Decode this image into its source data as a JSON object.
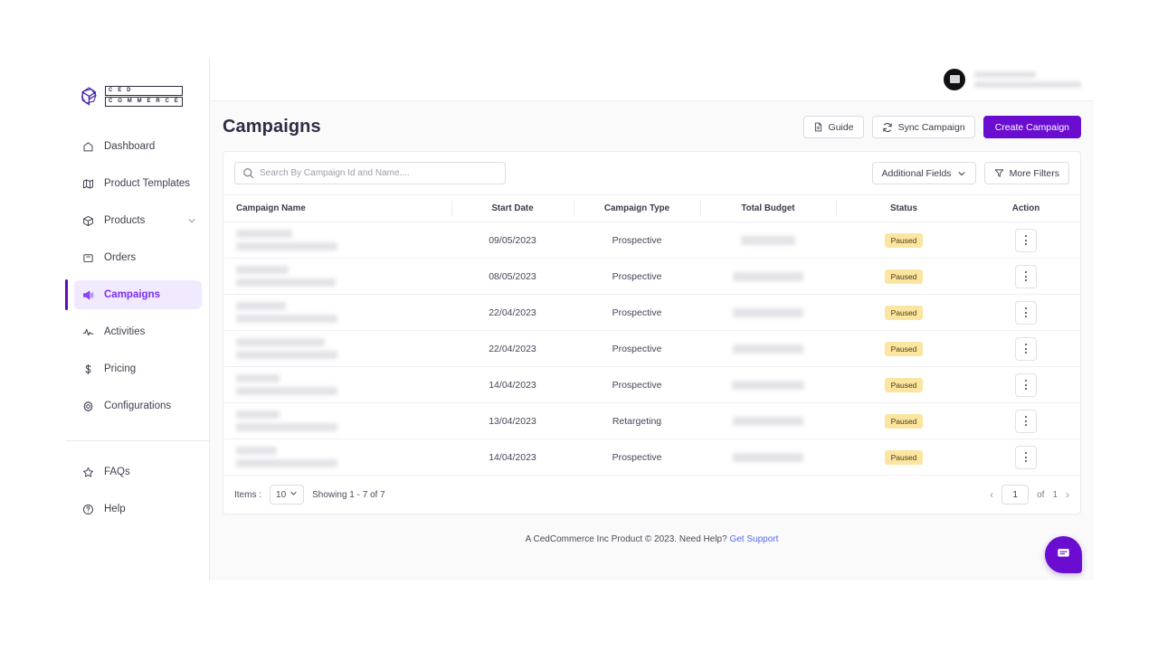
{
  "brand": {
    "name_line1": "C E D",
    "name_line2": "C O M M E R C E",
    "accent": "#6a0dd0",
    "active_bg": "#f1eaff",
    "active_text": "#7b2ff2"
  },
  "sidebar": {
    "items": [
      {
        "label": "Dashboard",
        "icon": "home-icon",
        "active": false,
        "chevron": false
      },
      {
        "label": "Product Templates",
        "icon": "map-icon",
        "active": false,
        "chevron": false
      },
      {
        "label": "Products",
        "icon": "box-icon",
        "active": false,
        "chevron": true
      },
      {
        "label": "Orders",
        "icon": "bag-icon",
        "active": false,
        "chevron": false
      },
      {
        "label": "Campaigns",
        "icon": "megaphone-icon",
        "active": true,
        "chevron": false
      },
      {
        "label": "Activities",
        "icon": "activity-icon",
        "active": false,
        "chevron": false
      },
      {
        "label": "Pricing",
        "icon": "dollar-icon",
        "active": false,
        "chevron": false
      },
      {
        "label": "Configurations",
        "icon": "gear-icon",
        "active": false,
        "chevron": false
      }
    ],
    "bottom_items": [
      {
        "label": "FAQs",
        "icon": "star-icon"
      },
      {
        "label": "Help",
        "icon": "question-circle-icon"
      }
    ]
  },
  "topbar": {
    "avatar": "user-avatar",
    "user_name_redacted": true
  },
  "header": {
    "title": "Campaigns",
    "guide_label": "Guide",
    "sync_label": "Sync Campaign",
    "create_label": "Create Campaign"
  },
  "search": {
    "value": "",
    "placeholder": "Search By Campaign Id and Name...."
  },
  "filters": {
    "additional_fields_label": "Additional Fields",
    "more_filters_label": "More Filters"
  },
  "table": {
    "columns": [
      "Campaign Name",
      "Start Date",
      "Campaign Type",
      "Total Budget",
      "Status",
      "Action"
    ],
    "rows": [
      {
        "name_redacted": true,
        "name_w1": 62,
        "name_w2": 112,
        "start_date": "09/05/2023",
        "type": "Prospective",
        "budget_redacted": true,
        "budget_w": 60,
        "status": "Paused"
      },
      {
        "name_redacted": true,
        "name_w1": 58,
        "name_w2": 110,
        "start_date": "08/05/2023",
        "type": "Prospective",
        "budget_redacted": true,
        "budget_w": 78,
        "status": "Paused"
      },
      {
        "name_redacted": true,
        "name_w1": 55,
        "name_w2": 112,
        "start_date": "22/04/2023",
        "type": "Prospective",
        "budget_redacted": true,
        "budget_w": 78,
        "status": "Paused"
      },
      {
        "name_redacted": true,
        "name_w1": 98,
        "name_w2": 112,
        "start_date": "22/04/2023",
        "type": "Prospective",
        "budget_redacted": true,
        "budget_w": 78,
        "status": "Paused"
      },
      {
        "name_redacted": true,
        "name_w1": 48,
        "name_w2": 112,
        "start_date": "14/04/2023",
        "type": "Prospective",
        "budget_redacted": true,
        "budget_w": 80,
        "status": "Paused"
      },
      {
        "name_redacted": true,
        "name_w1": 48,
        "name_w2": 112,
        "start_date": "13/04/2023",
        "type": "Retargeting",
        "budget_redacted": true,
        "budget_w": 78,
        "status": "Paused"
      },
      {
        "name_redacted": true,
        "name_w1": 45,
        "name_w2": 112,
        "start_date": "14/04/2023",
        "type": "Prospective",
        "budget_redacted": true,
        "budget_w": 78,
        "status": "Paused"
      }
    ],
    "status_badge_bg": "#fbe5a1",
    "status_badge_color": "#4a3c10",
    "action_icon": "vertical-dots-icon"
  },
  "pagination": {
    "items_label": "Items :",
    "page_size": "10",
    "showing_text": "Showing 1 - 7 of 7",
    "current_page": "1",
    "of_label": "of",
    "total_pages": "1",
    "prev_icon": "chevron-left-icon",
    "next_icon": "chevron-right-icon"
  },
  "footer": {
    "text": "A CedCommerce Inc Product © 2023. Need Help?",
    "link_label": "Get Support"
  },
  "chat": {
    "icon": "chat-bubble-icon",
    "color": "#6a0dd0"
  }
}
